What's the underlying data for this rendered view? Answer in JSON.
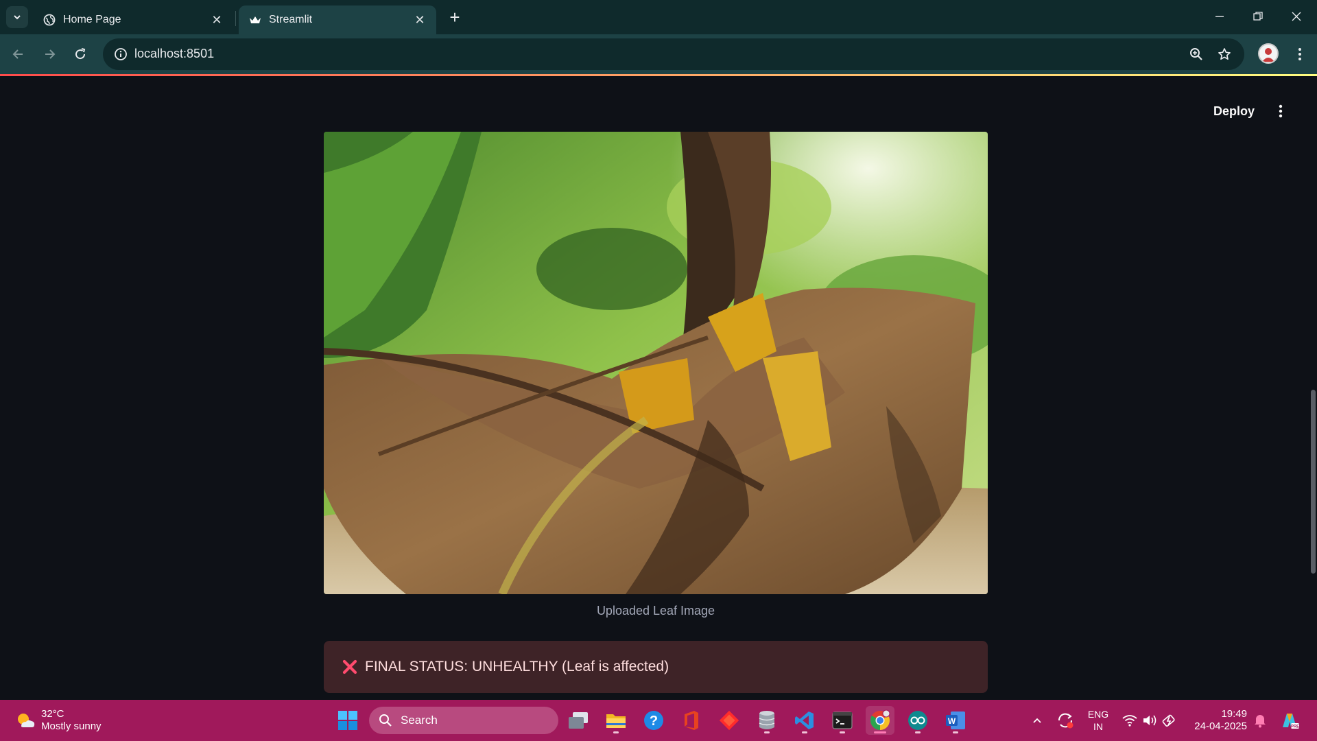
{
  "browser": {
    "tabs": [
      {
        "title": "Home Page",
        "favicon": "globe-icon",
        "active": false
      },
      {
        "title": "Streamlit",
        "favicon": "streamlit-crown-icon",
        "active": true
      }
    ],
    "url": "localhost:8501"
  },
  "app": {
    "deploy_label": "Deploy",
    "image_caption": "Uploaded Leaf Image",
    "status_message": "FINAL STATUS: UNHEALTHY (Leaf is affected)",
    "status_icon": "cross-mark-icon",
    "colors": {
      "background": "#0e1117",
      "error_bg": "#3e2327",
      "error_icon": "#ff4b4b",
      "accent": "#ff4b4b"
    }
  },
  "taskbar": {
    "weather": {
      "temp": "32°C",
      "condition": "Mostly sunny"
    },
    "search_placeholder": "Search",
    "language": {
      "line1": "ENG",
      "line2": "IN"
    },
    "clock": {
      "time": "19:49",
      "date": "24-04-2025"
    },
    "apps": [
      "windows-start-icon",
      "task-view-icon",
      "file-explorer-icon",
      "help-icon",
      "office-icon",
      "git-icon",
      "database-icon",
      "vscode-icon",
      "terminal-icon",
      "chrome-icon",
      "arduino-icon",
      "word-icon"
    ]
  }
}
